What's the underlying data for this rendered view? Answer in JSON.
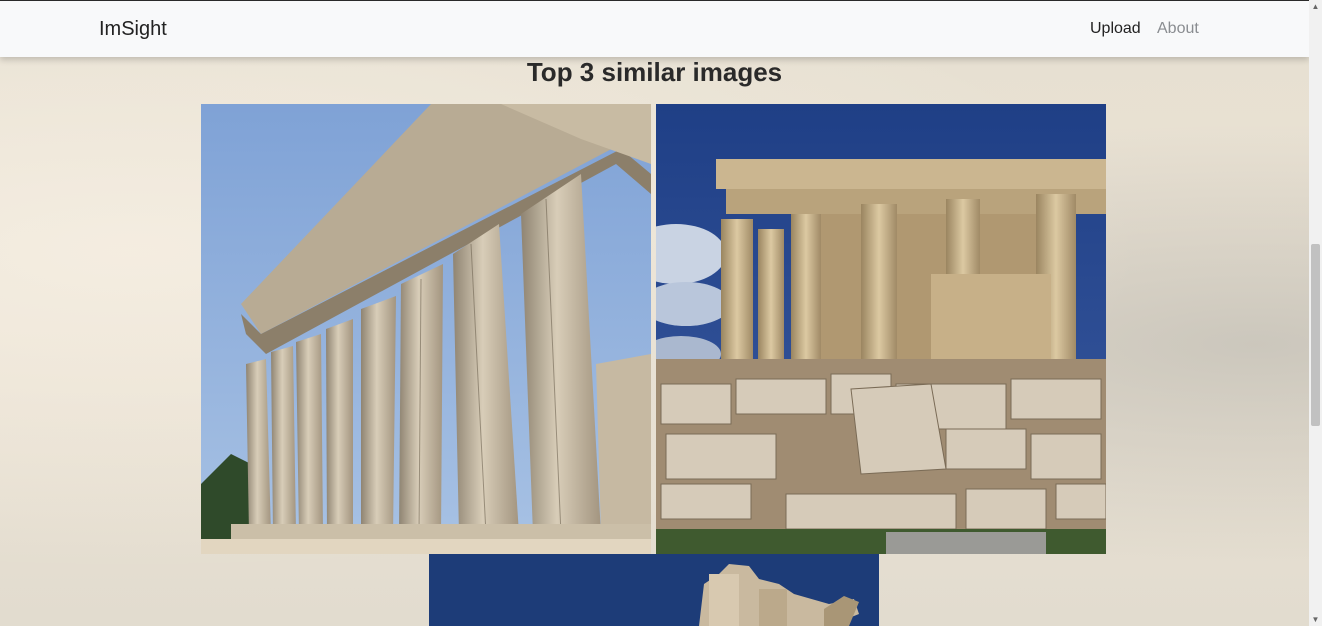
{
  "navbar": {
    "brand": "ImSight",
    "links": [
      {
        "label": "Upload"
      },
      {
        "label": "About"
      }
    ]
  },
  "main": {
    "title": "Top 3 similar images",
    "images": [
      {
        "description_icon": "image-parthenon-columns-side"
      },
      {
        "description_icon": "image-parthenon-ruins-front"
      },
      {
        "description_icon": "image-parthenon-top-detail"
      }
    ]
  },
  "scrollbar": {
    "up_icon": "▲",
    "down_icon": "▼"
  }
}
